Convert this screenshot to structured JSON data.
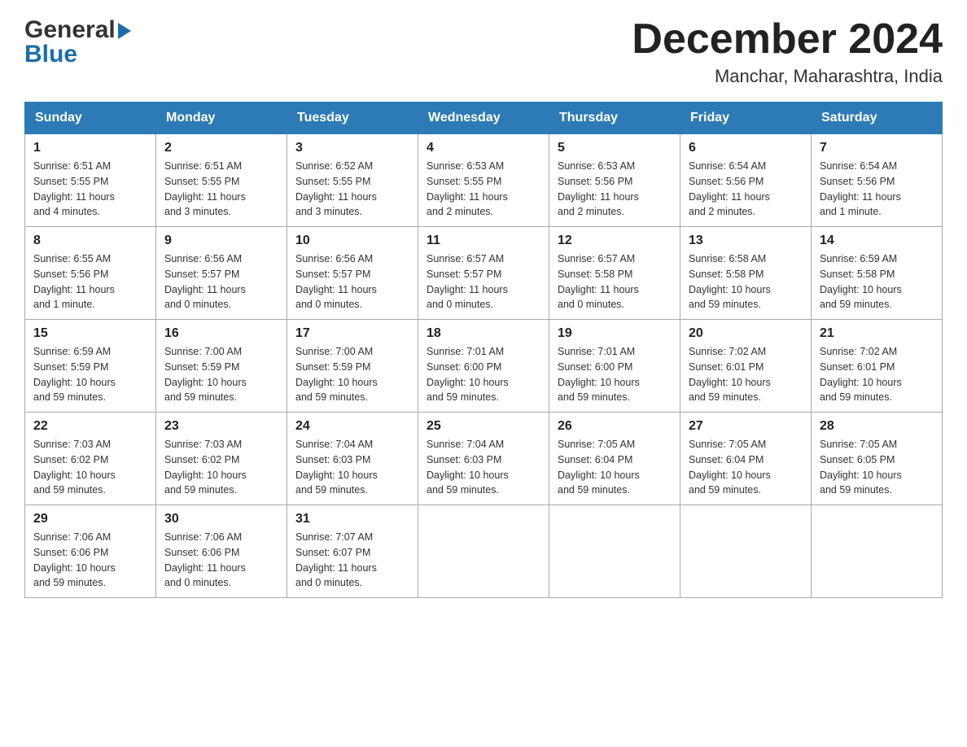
{
  "header": {
    "title": "December 2024",
    "subtitle": "Manchar, Maharashtra, India",
    "logo_general": "General",
    "logo_blue": "Blue"
  },
  "days_of_week": [
    "Sunday",
    "Monday",
    "Tuesday",
    "Wednesday",
    "Thursday",
    "Friday",
    "Saturday"
  ],
  "weeks": [
    [
      {
        "day": "1",
        "sunrise": "6:51 AM",
        "sunset": "5:55 PM",
        "daylight": "11 hours and 4 minutes."
      },
      {
        "day": "2",
        "sunrise": "6:51 AM",
        "sunset": "5:55 PM",
        "daylight": "11 hours and 3 minutes."
      },
      {
        "day": "3",
        "sunrise": "6:52 AM",
        "sunset": "5:55 PM",
        "daylight": "11 hours and 3 minutes."
      },
      {
        "day": "4",
        "sunrise": "6:53 AM",
        "sunset": "5:55 PM",
        "daylight": "11 hours and 2 minutes."
      },
      {
        "day": "5",
        "sunrise": "6:53 AM",
        "sunset": "5:56 PM",
        "daylight": "11 hours and 2 minutes."
      },
      {
        "day": "6",
        "sunrise": "6:54 AM",
        "sunset": "5:56 PM",
        "daylight": "11 hours and 2 minutes."
      },
      {
        "day": "7",
        "sunrise": "6:54 AM",
        "sunset": "5:56 PM",
        "daylight": "11 hours and 1 minute."
      }
    ],
    [
      {
        "day": "8",
        "sunrise": "6:55 AM",
        "sunset": "5:56 PM",
        "daylight": "11 hours and 1 minute."
      },
      {
        "day": "9",
        "sunrise": "6:56 AM",
        "sunset": "5:57 PM",
        "daylight": "11 hours and 0 minutes."
      },
      {
        "day": "10",
        "sunrise": "6:56 AM",
        "sunset": "5:57 PM",
        "daylight": "11 hours and 0 minutes."
      },
      {
        "day": "11",
        "sunrise": "6:57 AM",
        "sunset": "5:57 PM",
        "daylight": "11 hours and 0 minutes."
      },
      {
        "day": "12",
        "sunrise": "6:57 AM",
        "sunset": "5:58 PM",
        "daylight": "11 hours and 0 minutes."
      },
      {
        "day": "13",
        "sunrise": "6:58 AM",
        "sunset": "5:58 PM",
        "daylight": "10 hours and 59 minutes."
      },
      {
        "day": "14",
        "sunrise": "6:59 AM",
        "sunset": "5:58 PM",
        "daylight": "10 hours and 59 minutes."
      }
    ],
    [
      {
        "day": "15",
        "sunrise": "6:59 AM",
        "sunset": "5:59 PM",
        "daylight": "10 hours and 59 minutes."
      },
      {
        "day": "16",
        "sunrise": "7:00 AM",
        "sunset": "5:59 PM",
        "daylight": "10 hours and 59 minutes."
      },
      {
        "day": "17",
        "sunrise": "7:00 AM",
        "sunset": "5:59 PM",
        "daylight": "10 hours and 59 minutes."
      },
      {
        "day": "18",
        "sunrise": "7:01 AM",
        "sunset": "6:00 PM",
        "daylight": "10 hours and 59 minutes."
      },
      {
        "day": "19",
        "sunrise": "7:01 AM",
        "sunset": "6:00 PM",
        "daylight": "10 hours and 59 minutes."
      },
      {
        "day": "20",
        "sunrise": "7:02 AM",
        "sunset": "6:01 PM",
        "daylight": "10 hours and 59 minutes."
      },
      {
        "day": "21",
        "sunrise": "7:02 AM",
        "sunset": "6:01 PM",
        "daylight": "10 hours and 59 minutes."
      }
    ],
    [
      {
        "day": "22",
        "sunrise": "7:03 AM",
        "sunset": "6:02 PM",
        "daylight": "10 hours and 59 minutes."
      },
      {
        "day": "23",
        "sunrise": "7:03 AM",
        "sunset": "6:02 PM",
        "daylight": "10 hours and 59 minutes."
      },
      {
        "day": "24",
        "sunrise": "7:04 AM",
        "sunset": "6:03 PM",
        "daylight": "10 hours and 59 minutes."
      },
      {
        "day": "25",
        "sunrise": "7:04 AM",
        "sunset": "6:03 PM",
        "daylight": "10 hours and 59 minutes."
      },
      {
        "day": "26",
        "sunrise": "7:05 AM",
        "sunset": "6:04 PM",
        "daylight": "10 hours and 59 minutes."
      },
      {
        "day": "27",
        "sunrise": "7:05 AM",
        "sunset": "6:04 PM",
        "daylight": "10 hours and 59 minutes."
      },
      {
        "day": "28",
        "sunrise": "7:05 AM",
        "sunset": "6:05 PM",
        "daylight": "10 hours and 59 minutes."
      }
    ],
    [
      {
        "day": "29",
        "sunrise": "7:06 AM",
        "sunset": "6:06 PM",
        "daylight": "10 hours and 59 minutes."
      },
      {
        "day": "30",
        "sunrise": "7:06 AM",
        "sunset": "6:06 PM",
        "daylight": "11 hours and 0 minutes."
      },
      {
        "day": "31",
        "sunrise": "7:07 AM",
        "sunset": "6:07 PM",
        "daylight": "11 hours and 0 minutes."
      },
      null,
      null,
      null,
      null
    ]
  ],
  "labels": {
    "sunrise": "Sunrise:",
    "sunset": "Sunset:",
    "daylight": "Daylight:"
  }
}
